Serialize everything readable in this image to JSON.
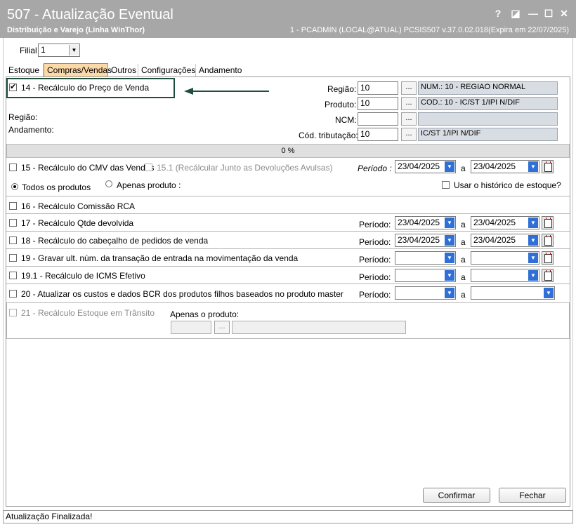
{
  "window": {
    "title": "507 - Atualização Eventual",
    "subtitle": "Distribuição e Varejo (Linha WinThor)",
    "info": "1 - PCADMIN (LOCAL@ATUAL)   PCSIS507  v.37.0.02.018(Expira em 22/07/2025)",
    "buttons": {
      "help": "?",
      "restore": "◪",
      "minimize": "—",
      "maximize": "☐",
      "close": "✕"
    }
  },
  "filial": {
    "label": "Filial",
    "value": "1"
  },
  "tabs": [
    "Estoque",
    "Compras/Vendas",
    "Outros",
    "Configurações",
    "Andamento"
  ],
  "active_tab": "Compras/Vendas",
  "section14": {
    "checkbox_label": "14 - Recálculo do Preço de Venda",
    "checked": true,
    "checkmark": "✔",
    "regiao_label": "Região:",
    "andamento_label": "Andamento:",
    "fields": {
      "regiao": {
        "label": "Região:",
        "value": "10",
        "desc": "NUM.: 10 - REGIAO NORMAL"
      },
      "produto": {
        "label": "Produto:",
        "value": "10",
        "desc": "COD.: 10 - IC/ST 1/IPI N/DIF"
      },
      "ncm": {
        "label": "NCM:",
        "value": "",
        "desc": ""
      },
      "cod_tributacao": {
        "label": "Cód. tributação:",
        "value": "10",
        "desc": "IC/ST 1/IPI N/DIF"
      }
    },
    "dots": "..."
  },
  "progress": {
    "text": "0 %",
    "value": 0
  },
  "section15": {
    "label": "15 - Recálculo do CMV das Vendas",
    "sub_label": "15.1 (Recálcular Junto as Devoluções Avulsas)",
    "periodo_label": "Período :",
    "date_from": "23/04/2025",
    "a_label": "a",
    "date_to": "23/04/2025",
    "radio_all": "Todos os produtos",
    "radio_one": "Apenas produto :",
    "usar_historico": "Usar o histórico de estoque?"
  },
  "rows": [
    {
      "label": "16 - Recálculo Comissão RCA"
    },
    {
      "label": "17 - Recálculo Qtde devolvida",
      "periodo": "Período:",
      "from": "23/04/2025",
      "a": "a",
      "to": "23/04/2025"
    },
    {
      "label": "18 - Recálculo do cabeçalho de pedidos de venda",
      "periodo": "Período:",
      "from": "23/04/2025",
      "a": "a",
      "to": "23/04/2025"
    },
    {
      "label": "19 - Gravar ult. núm. da transação de entrada na movimentação da venda",
      "periodo": "Período:",
      "from": "",
      "a": "a",
      "to": ""
    },
    {
      "label": "19.1 - Recálculo de ICMS Efetivo",
      "periodo": "Período:",
      "from": "",
      "a": "a",
      "to": ""
    },
    {
      "label": "20 - Atualizar os custos e dados BCR dos produtos filhos baseados no produto master",
      "periodo": "Período:",
      "from": "",
      "a": "a",
      "to": ""
    }
  ],
  "section21": {
    "label": "21 - Recálculo Estoque em Trânsito",
    "apenas_label": "Apenas o produto:",
    "dots": "..."
  },
  "buttons": {
    "confirmar": "Confirmar",
    "fechar": "Fechar"
  },
  "status": "Atualização Finalizada!",
  "colors": {
    "titlebar": "#a7a7a7",
    "active_tab": "#fcd9a8",
    "highlight_box": "#1f4e3d",
    "arrow": "#1f4e3d",
    "combo_button": "#2f6fd6"
  }
}
